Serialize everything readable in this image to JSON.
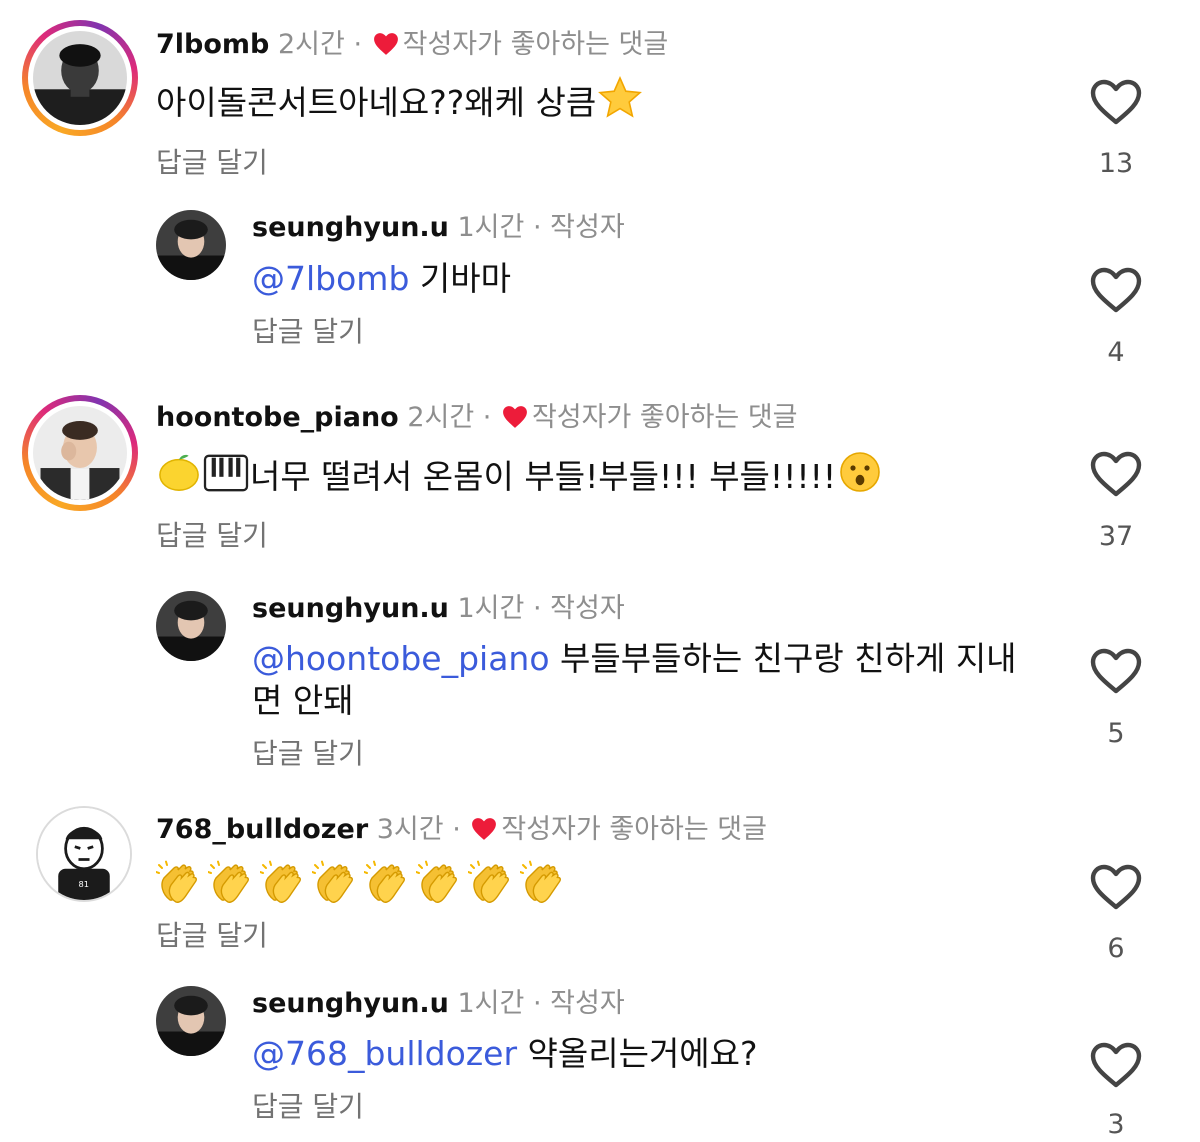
{
  "comments": [
    {
      "username": "7lbomb",
      "time": "2시간",
      "liked_label": "작성자가 좋아하는 댓글",
      "text": "아이돌콘서트아네요??왜케 상큼",
      "text_emoji": "star",
      "reply": "답글 달기",
      "likes": "13",
      "replies": [
        {
          "username": "seunghyun.u",
          "time": "1시간",
          "author_tag": "작성자",
          "mention": "@7lbomb",
          "text": " 기바마",
          "reply": "답글 달기",
          "likes": "4"
        }
      ]
    },
    {
      "username": "hoontobe_piano",
      "time": "2시간",
      "liked_label": "작성자가 좋아하는 댓글",
      "text": "너무 떨려서 온몸이 부들!부들!!! 부들!!!!!",
      "text_emoji_before": [
        "lemon",
        "piano"
      ],
      "text_emoji_after": "hushed-face",
      "reply": "답글 달기",
      "likes": "37",
      "replies": [
        {
          "username": "seunghyun.u",
          "time": "1시간",
          "author_tag": "작성자",
          "mention": "@hoontobe_piano",
          "text_line1": " 부들부들하는 친구랑 친하게 지내",
          "text_line2": "면 안돼",
          "reply": "답글 달기",
          "likes": "5"
        }
      ]
    },
    {
      "username": "768_bulldozer",
      "time": "3시간",
      "liked_label": "작성자가 좋아하는 댓글",
      "text_emoji": "clapping-hands",
      "text_emoji_count": 8,
      "reply": "답글 달기",
      "likes": "6",
      "replies": [
        {
          "username": "seunghyun.u",
          "time": "1시간",
          "author_tag": "작성자",
          "mention": "@768_bulldozer",
          "text": " 약올리는거에요?",
          "reply": "답글 달기",
          "likes": "3"
        }
      ]
    }
  ],
  "separator": "·",
  "colors": {
    "mention": "#3b5bdb",
    "liked_heart": "#ed1c3a",
    "secondary_text": "#8e8e8e"
  }
}
